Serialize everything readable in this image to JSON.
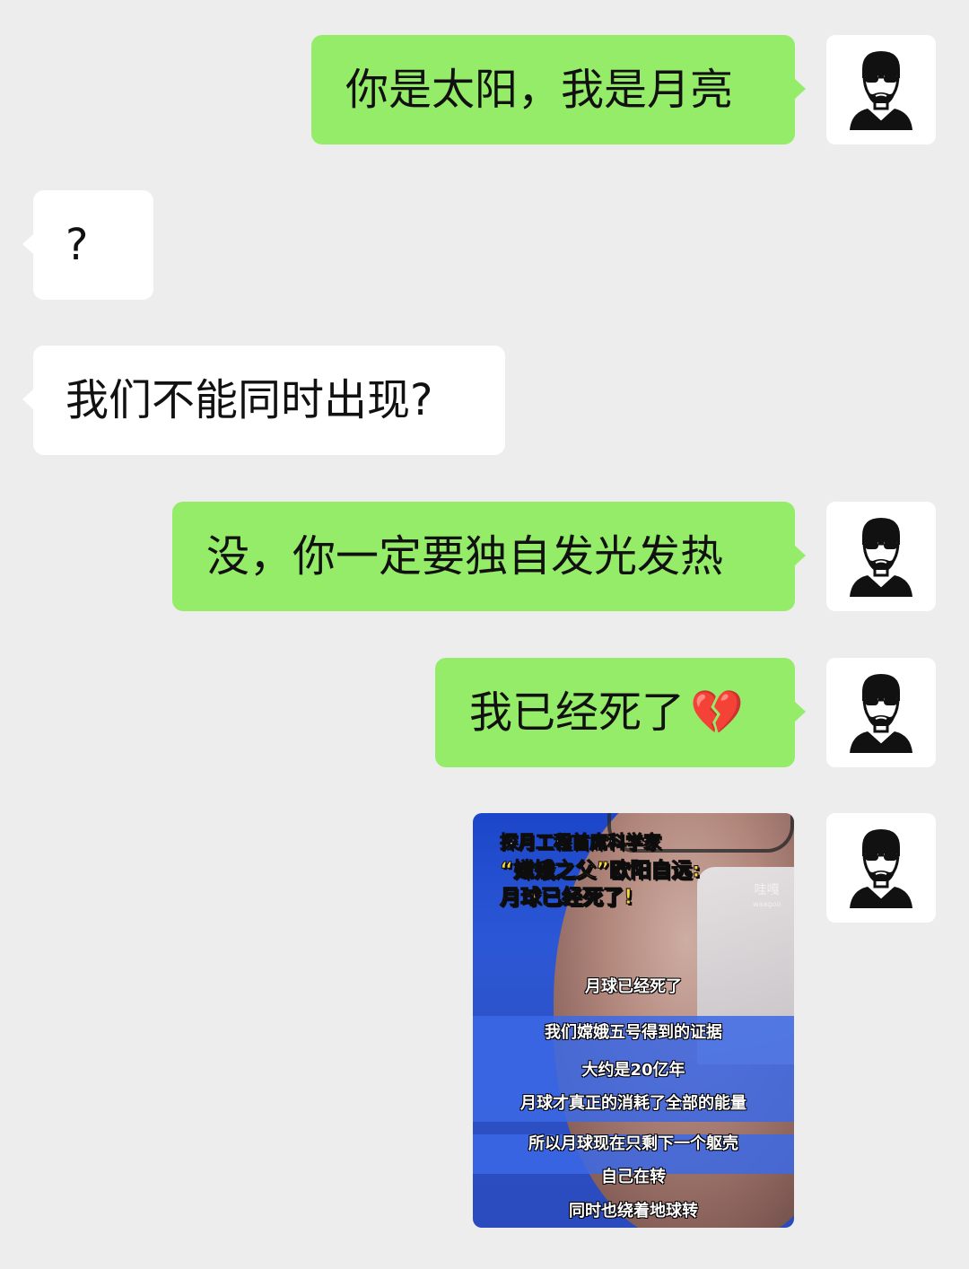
{
  "messages": [
    {
      "side": "right",
      "text": "你是太阳，我是月亮"
    },
    {
      "side": "left",
      "text": "?"
    },
    {
      "side": "left",
      "text": "我们不能同时出现?"
    },
    {
      "side": "right",
      "text": "没，你一定要独自发光发热"
    },
    {
      "side": "right",
      "text": "我已经死了",
      "emoji": "💔"
    }
  ],
  "video": {
    "headline_line1": "探月工程首席科学家",
    "headline_line2": "“嫦娥之父”欧阳自远:",
    "headline_line3": "月球已经死了!",
    "watermark": "哇嘎",
    "watermark_sub": "waagoo",
    "subtitles": [
      "月球已经死了",
      "我们嫦娥五号得到的证据",
      "大约是20亿年",
      "月球才真正的消耗了全部的能量",
      "所以月球现在只剩下一个躯壳",
      "自己在转",
      "同时也绕着地球转"
    ]
  },
  "colors": {
    "background": "#ededed",
    "sent_bubble": "#95ec69",
    "received_bubble": "#ffffff",
    "heart": "#e0245e"
  },
  "icons": {
    "avatar": "man-sunglasses-beard-icon",
    "emoji": "broken-heart-icon"
  }
}
